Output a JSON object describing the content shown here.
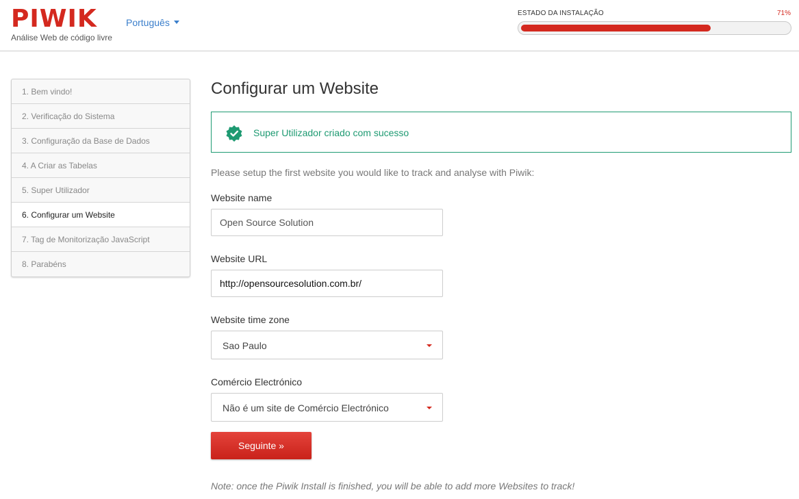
{
  "header": {
    "logo_text": "PIWIK",
    "tagline": "Análise Web de código livre",
    "language": "Português",
    "progress": {
      "label": "ESTADO DA INSTALAÇÃO",
      "percent_text": "71%",
      "value": 0.71
    }
  },
  "steps": [
    {
      "label": "1. Bem vindo!"
    },
    {
      "label": "2. Verificação do Sistema"
    },
    {
      "label": "3. Configuração da Base de Dados"
    },
    {
      "label": "4. A Criar as Tabelas"
    },
    {
      "label": "5. Super Utilizador"
    },
    {
      "label": "6. Configurar um Website"
    },
    {
      "label": "7. Tag de Monitorização JavaScript"
    },
    {
      "label": "8. Parabéns"
    }
  ],
  "main": {
    "title": "Configurar um Website",
    "success_message": "Super Utilizador criado com sucesso",
    "intro": "Please setup the first website you would like to track and analyse with Piwik:",
    "website_name": {
      "label": "Website name",
      "value": "Open Source Solution"
    },
    "website_url": {
      "label": "Website URL",
      "value": "http://opensourcesolution.com.br/"
    },
    "timezone": {
      "label": "Website time zone",
      "value": "Sao Paulo"
    },
    "ecommerce": {
      "label": "Comércio Electrónico",
      "value": "Não é um site de Comércio Electrónico"
    },
    "next_button": "Seguinte »",
    "note": "Note: once the Piwik Install is finished, you will be able to add more Websites to track!"
  },
  "colors": {
    "brand_red": "#d4291f",
    "link_blue": "#3a7ecb",
    "success_green": "#1e9a72"
  },
  "icons": {
    "success": "check-badge-icon",
    "dropdown": "caret-down-icon"
  }
}
